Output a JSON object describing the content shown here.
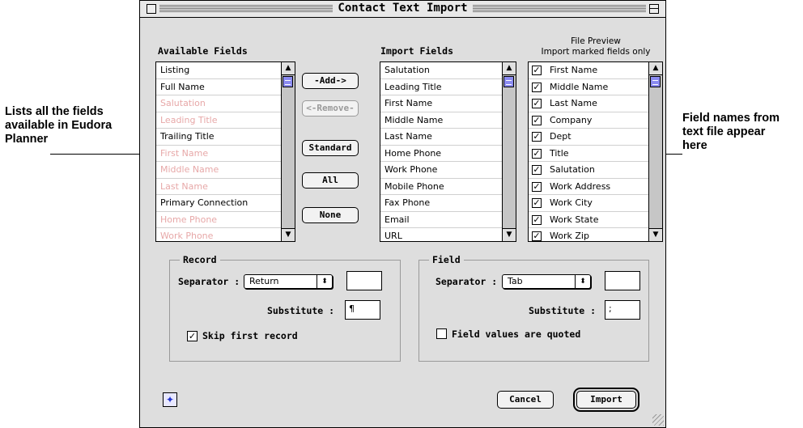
{
  "callouts": {
    "left": [
      "Lists all the fields",
      "available in Eudora",
      "Planner"
    ],
    "right": [
      "Field names from",
      "text file appear",
      "here"
    ]
  },
  "window": {
    "title": "Contact Text Import"
  },
  "available": {
    "label": "Available Fields",
    "items": [
      {
        "label": "Listing",
        "dim": false
      },
      {
        "label": "Full Name",
        "dim": false
      },
      {
        "label": "Salutation",
        "dim": true
      },
      {
        "label": "Leading Title",
        "dim": true
      },
      {
        "label": "Trailing Title",
        "dim": false
      },
      {
        "label": "First Name",
        "dim": true
      },
      {
        "label": "Middle Name",
        "dim": true
      },
      {
        "label": "Last Name",
        "dim": true
      },
      {
        "label": "Primary Connection",
        "dim": false
      },
      {
        "label": "Home Phone",
        "dim": true
      },
      {
        "label": "Work Phone",
        "dim": true
      }
    ]
  },
  "buttons": {
    "add": "-Add->",
    "remove": "<-Remove-",
    "standard": "Standard",
    "all": "All",
    "none": "None",
    "cancel": "Cancel",
    "import": "Import"
  },
  "import_fields": {
    "label": "Import Fields",
    "items": [
      "Salutation",
      "Leading Title",
      "First Name",
      "Middle Name",
      "Last Name",
      "Home Phone",
      "Work Phone",
      "Mobile Phone",
      "Fax Phone",
      "Email",
      "URL"
    ]
  },
  "preview": {
    "label1": "File Preview",
    "label2": "Import marked fields only",
    "items": [
      "First Name",
      "Middle Name",
      "Last Name",
      "Company",
      "Dept",
      "Title",
      "Salutation",
      "Work Address",
      "Work City",
      "Work State",
      "Work Zip"
    ]
  },
  "record": {
    "title": "Record",
    "separator_label": "Separator :",
    "separator_value": "Return",
    "substitute_label": "Substitute :",
    "substitute_value": "¶",
    "skip_label": "Skip first record",
    "skip_checked": true
  },
  "field": {
    "title": "Field",
    "separator_label": "Separator :",
    "separator_value": "Tab",
    "substitute_label": "Substitute :",
    "substitute_value": ";",
    "quoted_label": "Field values are quoted",
    "quoted_checked": false
  },
  "colors": {
    "thumb": "#8a8af0",
    "dim_text": "#e7a8a8",
    "help": "#2233cc"
  },
  "icons": {
    "help": "help-icon"
  }
}
